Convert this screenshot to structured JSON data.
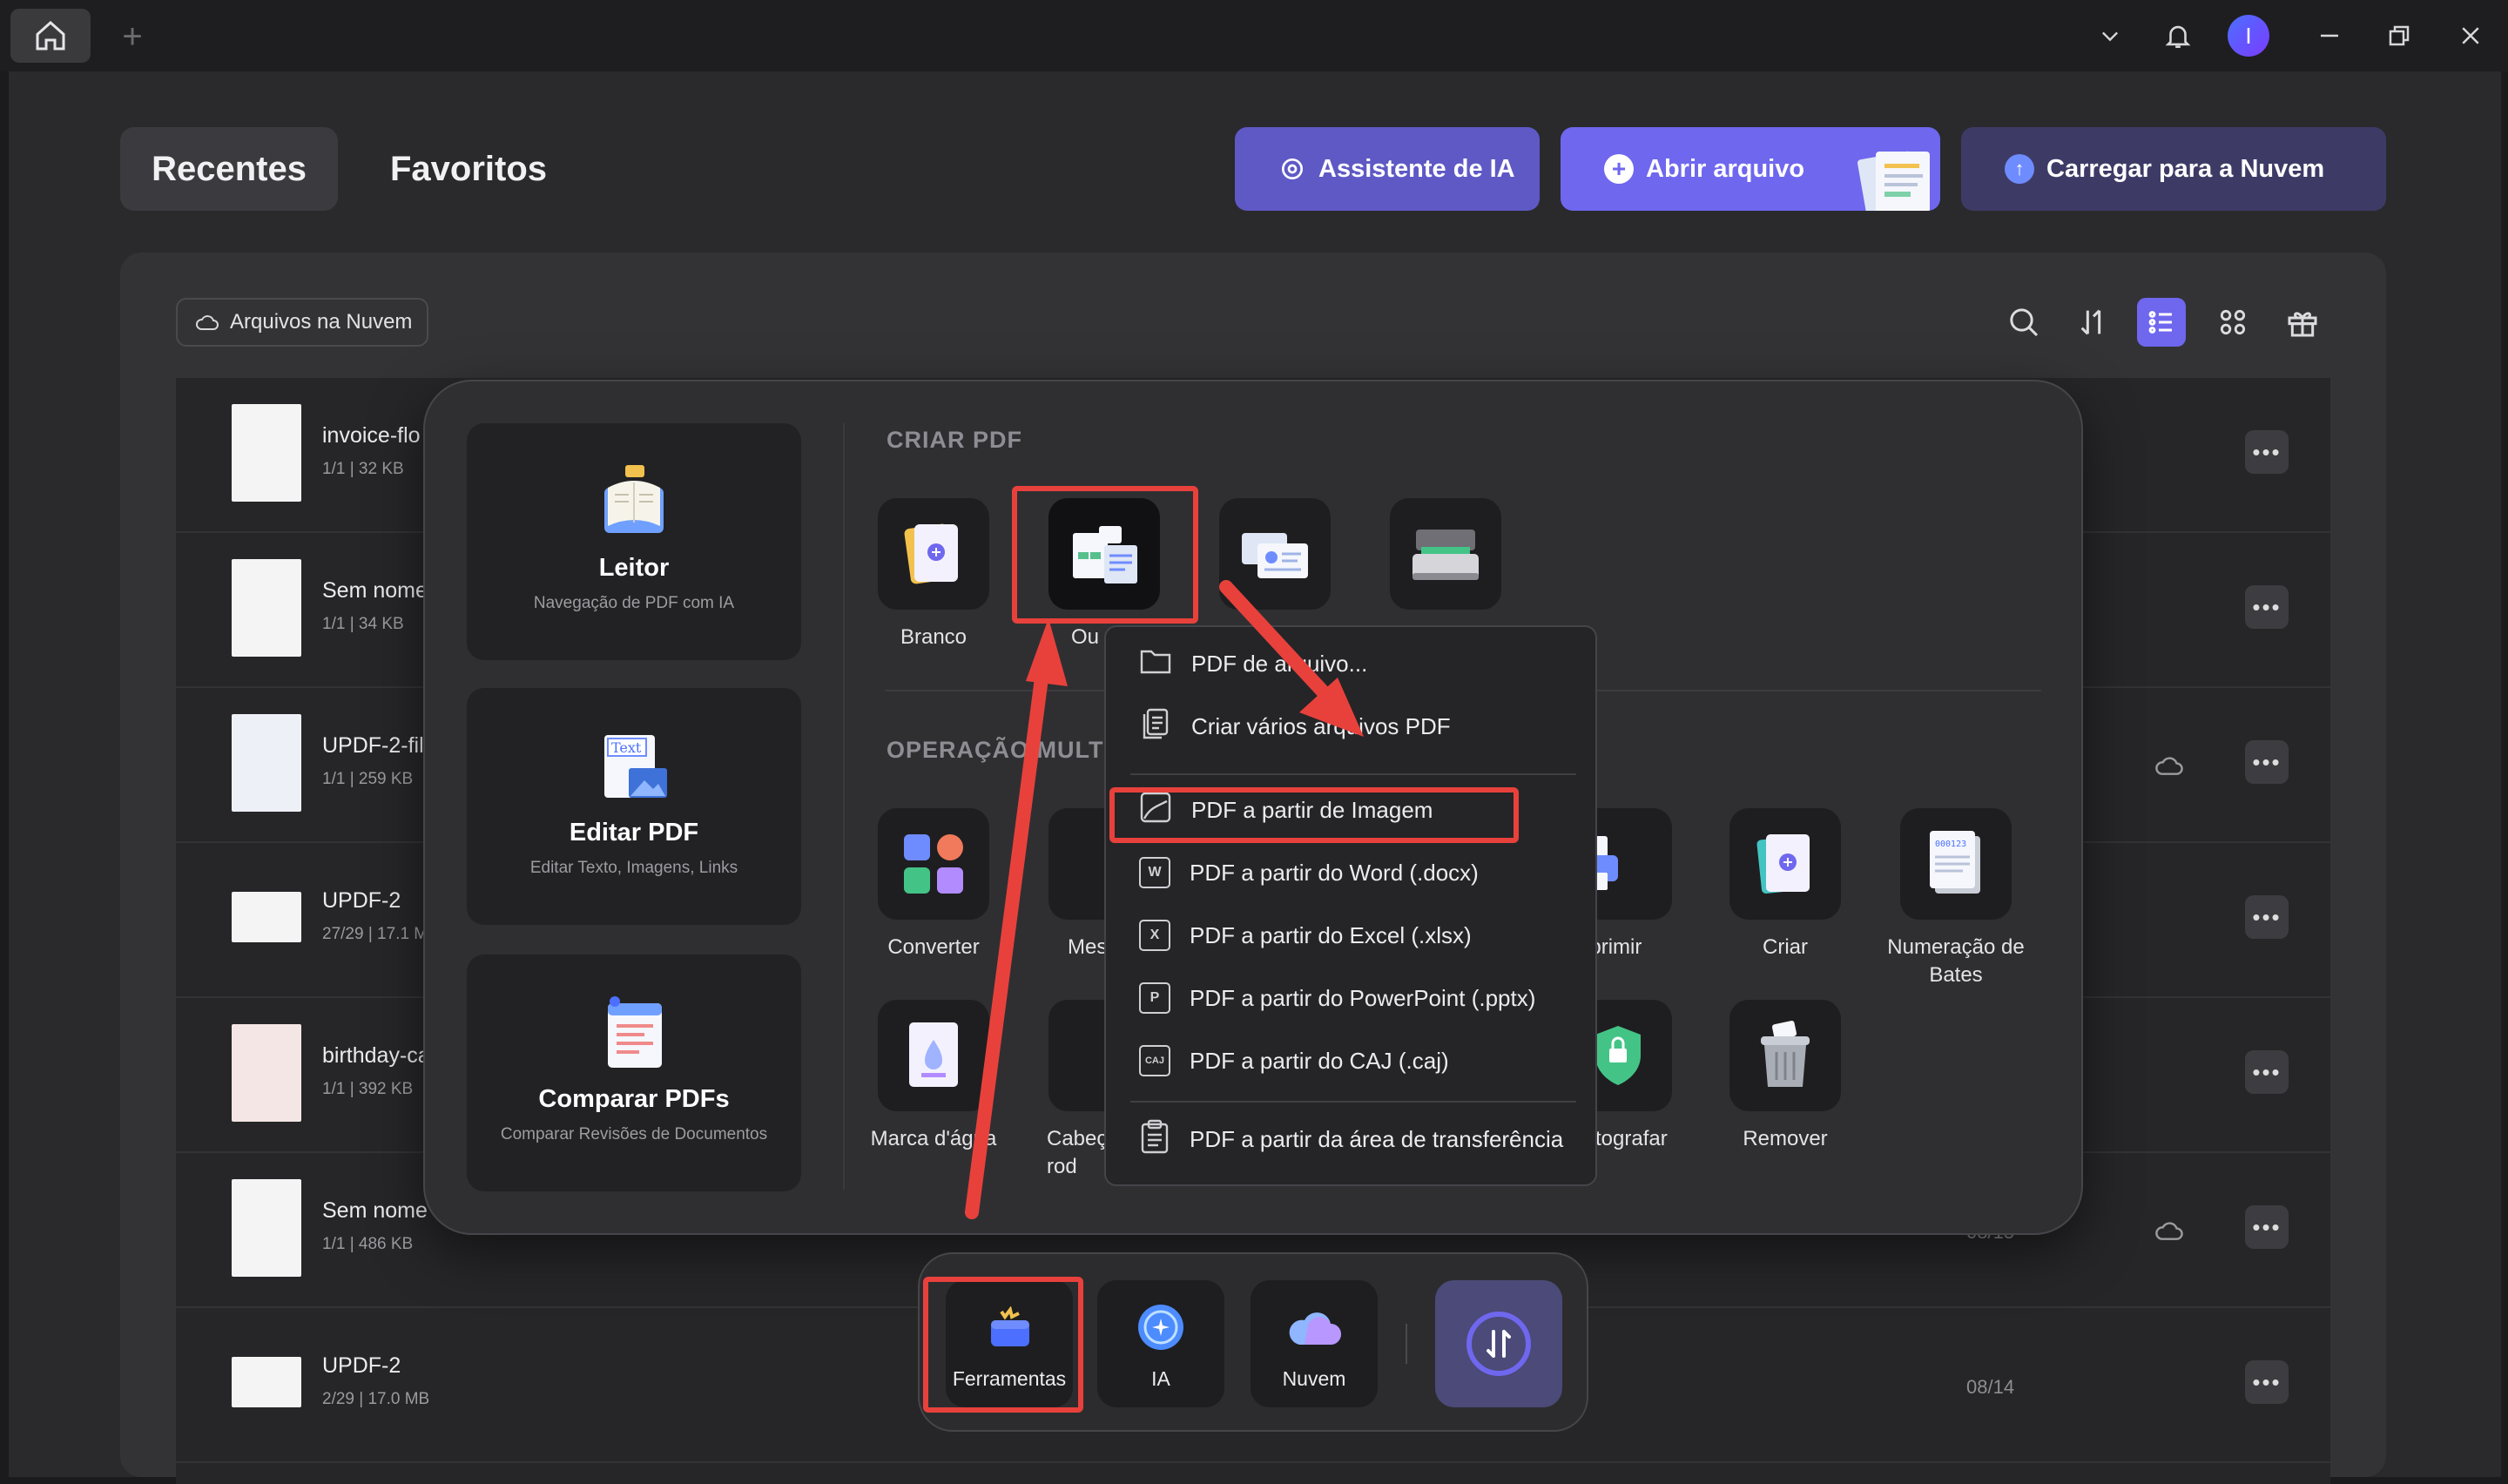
{
  "tabs": {
    "recent": "Recentes",
    "favorites": "Favoritos"
  },
  "actions": {
    "ai": "Assistente de IA",
    "open": "Abrir arquivo",
    "upload": "Carregar para a Nuvem"
  },
  "avatar_letter": "I",
  "cloud_chip": "Arquivos na Nuvem",
  "files": [
    {
      "name": "invoice-flo",
      "meta": "1/1 | 32 KB",
      "date": ""
    },
    {
      "name": "Sem nome",
      "meta": "1/1 | 34 KB",
      "date": ""
    },
    {
      "name": "UPDF-2-fil",
      "meta": "1/1 | 259 KB",
      "date": ""
    },
    {
      "name": "UPDF-2",
      "meta": "27/29 | 17.1 M",
      "date": ""
    },
    {
      "name": "birthday-ca",
      "meta": "1/1 | 392 KB",
      "date": ""
    },
    {
      "name": "Sem nome",
      "meta": "1/1 | 486 KB",
      "date": "08/15"
    },
    {
      "name": "UPDF-2",
      "meta": "2/29 | 17.0 MB",
      "date": "08/14"
    }
  ],
  "cards": [
    {
      "title": "Leitor",
      "subtitle": "Navegação de PDF com IA"
    },
    {
      "title": "Editar PDF",
      "subtitle": "Editar Texto, Imagens, Links"
    },
    {
      "title": "Comparar PDFs",
      "subtitle": "Comparar Revisões de Documentos"
    }
  ],
  "sections": {
    "create": "CRIAR PDF",
    "multi": "OPERAÇÃO MULTI-"
  },
  "create_tiles": {
    "blank": "Branco",
    "other": "Ou"
  },
  "multi_tiles": {
    "convert": "Converter",
    "merge": "Mes",
    "print": "nprimir",
    "create": "Criar",
    "bates": "Numeração de Bates",
    "watermark": "Marca d'água",
    "header": "Cabeç rod",
    "encrypt": "tografar",
    "remove": "Remover"
  },
  "menu": [
    {
      "label": "PDF de arquivo...",
      "icon": "folder-icon"
    },
    {
      "label": "Criar vários arquivos PDF",
      "icon": "multi-file-icon"
    },
    {
      "label": "PDF a partir de Imagem",
      "icon": "image-icon"
    },
    {
      "label": "PDF a partir do Word (.docx)",
      "icon": "word-icon"
    },
    {
      "label": "PDF a partir do Excel (.xlsx)",
      "icon": "excel-icon"
    },
    {
      "label": "PDF a partir do PowerPoint (.pptx)",
      "icon": "powerpoint-icon"
    },
    {
      "label": "PDF a partir do CAJ (.caj)",
      "icon": "caj-icon"
    },
    {
      "label": "PDF a partir da área de transferência",
      "icon": "clipboard-icon"
    }
  ],
  "dock": {
    "tools": "Ferramentas",
    "ai": "IA",
    "cloud": "Nuvem"
  },
  "colors": {
    "accent": "#6f67ee",
    "annotation": "#e8413c"
  }
}
